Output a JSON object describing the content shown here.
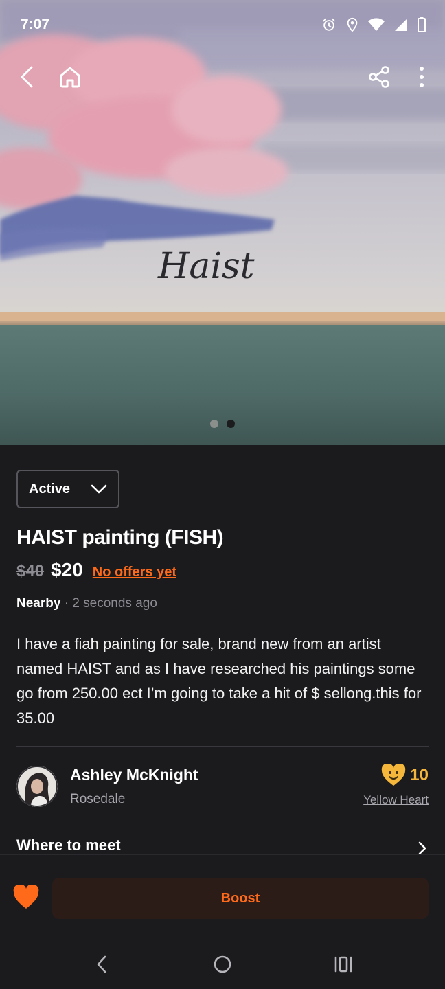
{
  "status_bar": {
    "time": "7:07",
    "icons": [
      "alarm-icon",
      "location-icon",
      "wifi-icon",
      "signal-icon",
      "battery-icon"
    ]
  },
  "hero": {
    "image_signature": "Haist",
    "image_count": 2,
    "active_image_index": 2,
    "nav": {
      "back_icon": "back-arrow-icon",
      "home_icon": "home-icon",
      "share_icon": "share-icon",
      "more_icon": "more-vertical-icon"
    }
  },
  "listing": {
    "status": "Active",
    "title": "HAIST painting (FISH)",
    "old_price": "$40",
    "price": "$20",
    "offers_text": "No offers yet",
    "location": "Nearby",
    "separator": "·",
    "posted": "2 seconds ago",
    "description": "I have a fiah painting for sale, brand new from an artist named  HAIST and as I have  researched his paintings some go from 250.00 ect I’m going to take a hit of $ sellong.this for 35.00"
  },
  "seller": {
    "name": "Ashley McKnight",
    "location": "Rosedale",
    "heart_count": "10",
    "heart_label": "Yellow Heart"
  },
  "sections": {
    "where_to_meet": "Where to meet"
  },
  "actions": {
    "boost_label": "Boost"
  },
  "colors": {
    "background": "#1b1b1e",
    "accent": "#ff6a1a",
    "heart_yellow": "#f5b73b",
    "boost_bg": "#2b1c17"
  }
}
